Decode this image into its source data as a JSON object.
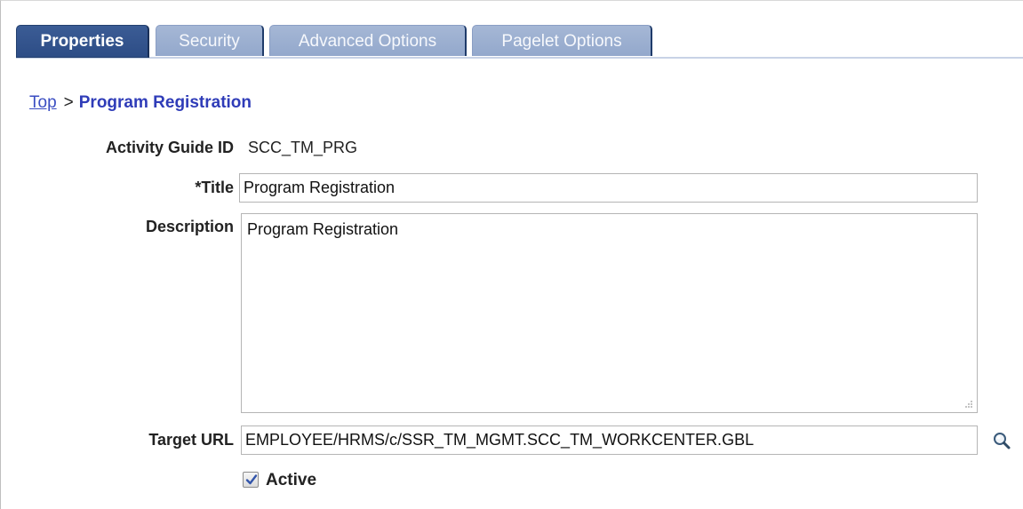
{
  "tabs": [
    {
      "label": "Properties",
      "active": true
    },
    {
      "label": "Security",
      "active": false
    },
    {
      "label": "Advanced Options",
      "active": false
    },
    {
      "label": "Pagelet Options",
      "active": false
    }
  ],
  "breadcrumb": {
    "top_link": "Top",
    "separator": ">",
    "current": "Program Registration"
  },
  "form": {
    "activity_guide_id_label": "Activity Guide ID",
    "activity_guide_id_value": "SCC_TM_PRG",
    "title_label": "*Title",
    "title_value": "Program Registration",
    "description_label": "Description",
    "description_value": "Program Registration",
    "target_url_label": "Target URL",
    "target_url_value": "EMPLOYEE/HRMS/c/SSR_TM_MGMT.SCC_TM_WORKCENTER.GBL",
    "active_label": "Active",
    "active_checked": true
  },
  "icons": {
    "lookup": "magnifier-icon",
    "checkbox": "checkmark-icon"
  },
  "colors": {
    "active_tab": "#2d4d86",
    "inactive_tab": "#93a8cc",
    "link": "#3b4ec2"
  }
}
